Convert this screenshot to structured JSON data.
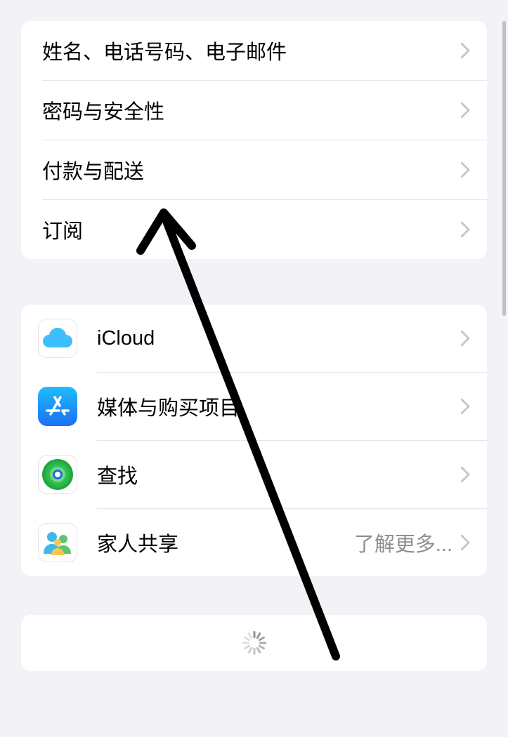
{
  "section1": {
    "items": [
      {
        "label": "姓名、电话号码、电子邮件"
      },
      {
        "label": "密码与安全性"
      },
      {
        "label": "付款与配送"
      },
      {
        "label": "订阅"
      }
    ]
  },
  "section2": {
    "items": [
      {
        "label": "iCloud",
        "icon": "icloud"
      },
      {
        "label": "媒体与购买项目",
        "icon": "appstore"
      },
      {
        "label": "查找",
        "icon": "findmy"
      },
      {
        "label": "家人共享",
        "icon": "family",
        "detail": "了解更多..."
      }
    ]
  }
}
